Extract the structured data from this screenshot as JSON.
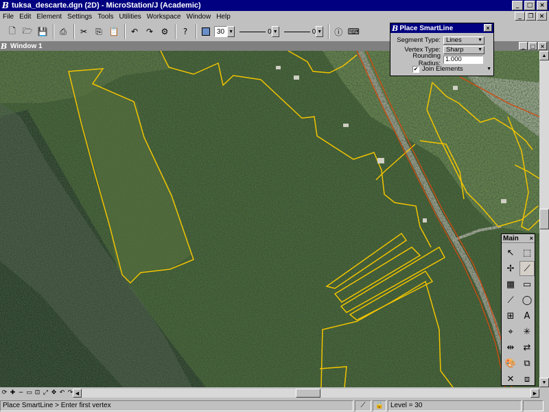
{
  "app": {
    "title": "tuksa_descarte.dgn (2D) - MicroStation/J (Academic)"
  },
  "menu": {
    "items": [
      "File",
      "Edit",
      "Element",
      "Settings",
      "Tools",
      "Utilities",
      "Workspace",
      "Window",
      "Help"
    ]
  },
  "toolbar": {
    "weight_value": "30",
    "style_value": "0",
    "line_weight_value": "0"
  },
  "view": {
    "window_title": "Window 1"
  },
  "smartline": {
    "title": "Place SmartLine",
    "segment_type_label": "Segment Type:",
    "segment_type_value": "Lines",
    "vertex_type_label": "Vertex Type:",
    "vertex_type_value": "Sharp",
    "rounding_radius_label": "Rounding Radius:",
    "rounding_radius_value": "1.000",
    "join_elements_label": "Join Elements",
    "join_elements_checked": true
  },
  "palette": {
    "title": "Main"
  },
  "status": {
    "prompt": "Place SmartLine > Enter first vertex",
    "level": "Level = 30"
  },
  "colors": {
    "active_color": "#6a8fc8",
    "boundary": "#f2c400",
    "boundary_dark": "#d24a10"
  }
}
